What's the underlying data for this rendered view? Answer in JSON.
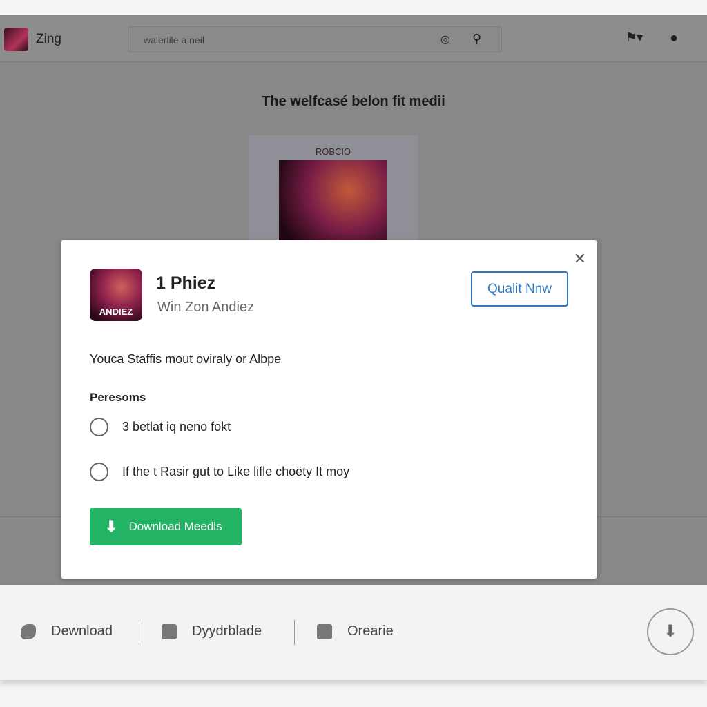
{
  "header": {
    "brand": "Zing",
    "search_placeholder": "walerlile a neil"
  },
  "page": {
    "headline": "The welfcasé belon fit medii",
    "cover_label": "ROBCIO"
  },
  "modal": {
    "thumb_label": "ANDIEZ",
    "title": "1 Phiez",
    "subtitle": "Win Zon Andiez",
    "quality_button": "Qualit Nnw",
    "description": "Youca Staffis mout oviraly or Albpe",
    "section_label": "Peresoms",
    "options": [
      {
        "label": "3 betlat iq  neno fokt",
        "selected": false
      },
      {
        "label": "If the t Rasir gut to Like lifle choëty It moy",
        "selected": false
      }
    ],
    "download_button": "Download Meedls",
    "accent_color": "#22b464",
    "link_color": "#2f78c4"
  },
  "bottom_bar": {
    "items": [
      {
        "label": "Dewnload",
        "icon": "puzzle-icon"
      },
      {
        "label": "Dyydrblade",
        "icon": "image-icon"
      },
      {
        "label": "Orearie",
        "icon": "user-icon"
      }
    ]
  }
}
